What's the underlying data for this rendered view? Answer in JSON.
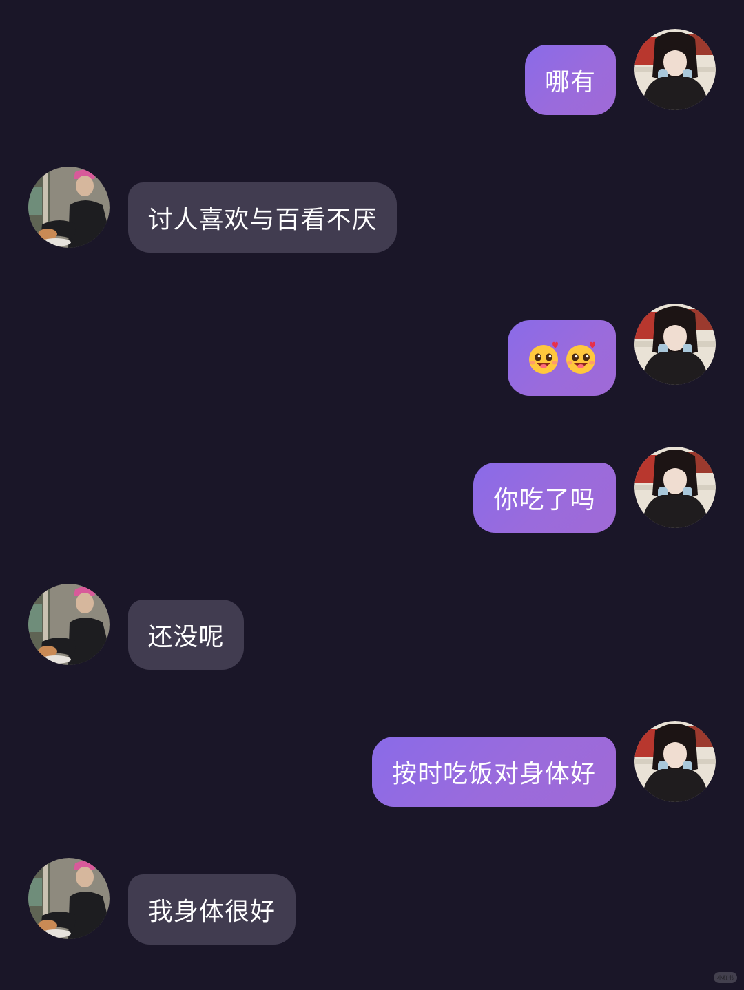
{
  "theme": {
    "background": "#1a1628",
    "sent_bubble_start": "#8a6be8",
    "sent_bubble_end": "#a06ad6",
    "received_bubble": "#413c50",
    "text": "#ffffff"
  },
  "messages": [
    {
      "sender": "self",
      "text": "哪有"
    },
    {
      "sender": "other",
      "text": "讨人喜欢与百看不厌"
    },
    {
      "sender": "self",
      "emojis": [
        "smiling-face-with-hearts-emoji",
        "smiling-face-with-hearts-emoji"
      ]
    },
    {
      "sender": "self",
      "text": "你吃了吗"
    },
    {
      "sender": "other",
      "text": "还没呢"
    },
    {
      "sender": "self",
      "text": "按时吃饭对身体好"
    },
    {
      "sender": "other",
      "text": "我身体很好"
    }
  ],
  "watermark": "小红书"
}
